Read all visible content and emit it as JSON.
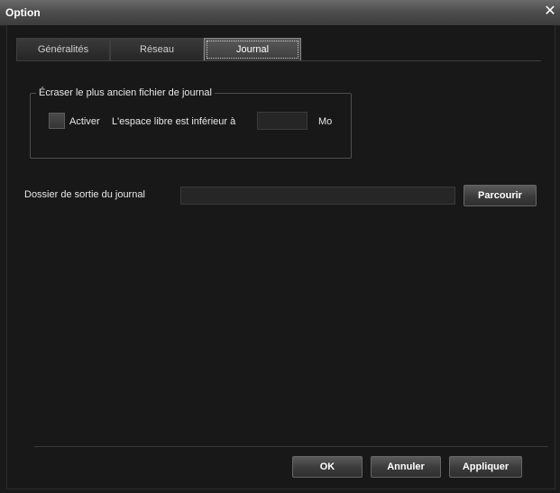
{
  "window": {
    "title": "Option",
    "close_icon": "close-icon"
  },
  "tabs": [
    {
      "label": "Généralités",
      "active": false
    },
    {
      "label": "Réseau",
      "active": false
    },
    {
      "label": "Journal",
      "active": true
    }
  ],
  "overwrite_group": {
    "legend": "Écraser le plus ancien fichier de journal",
    "enable_label": "Activer",
    "enable_checked": false,
    "free_space_label": "L'espace libre est inférieur à",
    "free_space_value": "",
    "unit": "Mo"
  },
  "output_folder": {
    "label": "Dossier de sortie du journal",
    "value": "",
    "browse_label": "Parcourir"
  },
  "footer": {
    "ok_label": "OK",
    "cancel_label": "Annuler",
    "apply_label": "Appliquer"
  }
}
